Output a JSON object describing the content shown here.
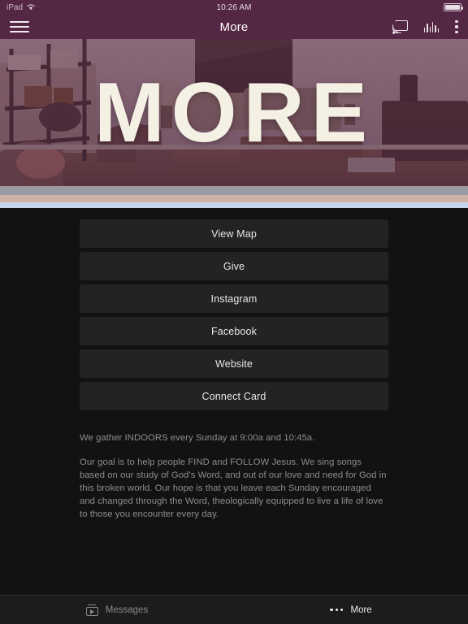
{
  "status_bar": {
    "device": "iPad",
    "wifi_icon": "wifi-icon",
    "time": "10:26 AM",
    "battery_icon": "battery-full-icon"
  },
  "nav_bar": {
    "menu_icon": "hamburger-menu-icon",
    "title": "More",
    "cast_icon": "chromecast-icon",
    "equalizer_icon": "equalizer-icon",
    "overflow_icon": "kebab-menu-icon",
    "background_color": "#542744"
  },
  "hero": {
    "title": "MORE",
    "image_alt": "living-room-interior",
    "overlay_color": "#542744",
    "title_color": "#f5f0e4",
    "accent_bands": [
      {
        "name": "gray-band",
        "color": "#9b9ba3"
      },
      {
        "name": "tan-band",
        "color": "#cdb3a8"
      },
      {
        "name": "blue-band",
        "color": "#c6d4ea"
      }
    ]
  },
  "main": {
    "buttons": [
      {
        "label": "View Map",
        "name": "view-map-button"
      },
      {
        "label": "Give",
        "name": "give-button"
      },
      {
        "label": "Instagram",
        "name": "instagram-button"
      },
      {
        "label": "Facebook",
        "name": "facebook-button"
      },
      {
        "label": "Website",
        "name": "website-button"
      },
      {
        "label": "Connect Card",
        "name": "connect-card-button"
      }
    ],
    "paragraphs": [
      "We gather INDOORS every Sunday at 9:00a and 10:45a.",
      "Our goal is to help people FIND and FOLLOW Jesus. We sing songs based on our study of God’s Word, and out of our love and need for God in this broken world. Our hope is that you leave each Sunday encouraged and changed through the Word, theologically equipped to live a life of love to those you encounter every day."
    ],
    "background_color": "#121212",
    "button_color": "#232323"
  },
  "tab_bar": {
    "tabs": [
      {
        "label": "Messages",
        "icon": "video-messages-icon",
        "active": false
      },
      {
        "label": "More",
        "icon": "ellipsis-icon",
        "active": true
      }
    ]
  }
}
